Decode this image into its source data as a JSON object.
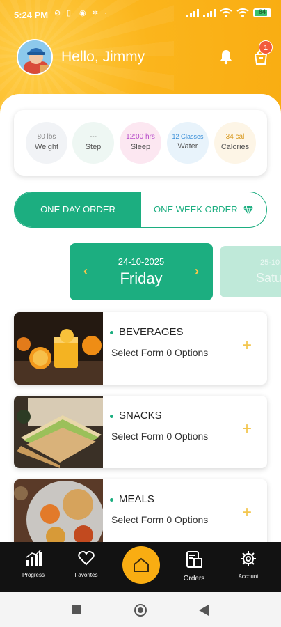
{
  "status_bar": {
    "time": "5:24 PM",
    "battery": "84"
  },
  "header": {
    "greeting": "Hello, Jimmy",
    "cart_count": "1"
  },
  "stats": [
    {
      "value": "80 lbs",
      "label": "Weight",
      "color": "#888888",
      "bg": "#f1f3f6"
    },
    {
      "value": "---",
      "label": "Step",
      "color": "#555555",
      "bg": "#eef7f3"
    },
    {
      "value": "12:00 hrs",
      "label": "Sleep",
      "color": "#b547c8",
      "bg": "#fce7f1"
    },
    {
      "value": "12 Glasses",
      "label": "Water",
      "color": "#3a8fd8",
      "bg": "#e8f3fb"
    },
    {
      "value": "34 cal",
      "label": "Calories",
      "color": "#d89a20",
      "bg": "#fdf5e6"
    }
  ],
  "order_toggle": {
    "left": "ONE DAY ORDER",
    "right": "ONE WEEK ORDER"
  },
  "dates": [
    {
      "date": "24-10-2025",
      "day": "Friday"
    },
    {
      "date": "25-10",
      "day": "Satu"
    }
  ],
  "categories": [
    {
      "title": "BEVERAGES",
      "subtitle": "Select Form 0 Options"
    },
    {
      "title": "SNACKS",
      "subtitle": "Select Form 0 Options"
    },
    {
      "title": "MEALS",
      "subtitle": "Select Form 0 Options"
    }
  ],
  "nav": {
    "progress": "Progress",
    "favorites": "Favorites",
    "orders": "Orders",
    "account": "Account"
  },
  "colors": {
    "accent": "#1cae80",
    "brand": "#f9ad12",
    "plus": "#f3c64e"
  }
}
